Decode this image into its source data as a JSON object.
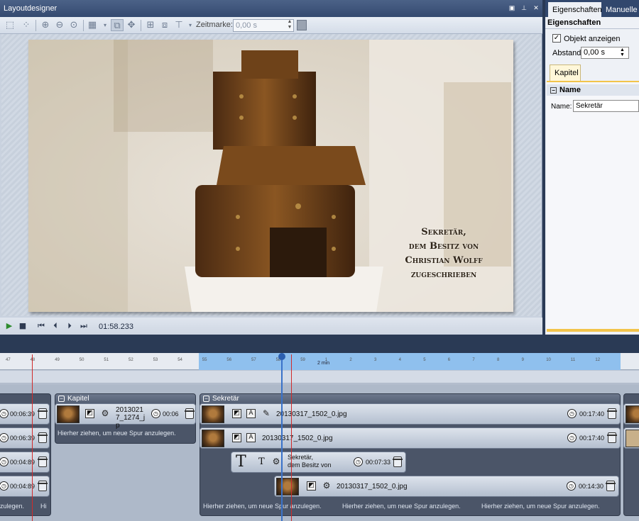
{
  "layoutdesigner": {
    "title": "Layoutdesigner",
    "zeitmarke_label": "Zeitmarke:",
    "zeitmarke_value": "0,00 s",
    "caption_lines": [
      "Sekretär,",
      "dem Besitz von",
      "Christian Wolff",
      "zugeschrieben"
    ],
    "timecode": "01:58.233"
  },
  "properties": {
    "tabs": [
      "Eigenschaften",
      "Manuelle Ei"
    ],
    "heading": "Eigenschaften",
    "show_object_label": "Objekt anzeigen",
    "show_object_checked": true,
    "abstand_label": "Abstand:",
    "abstand_value": "0,00 s",
    "section_tab": "Kapitel",
    "name_header": "Name",
    "name_label": "Name:",
    "name_value": "Sekretär"
  },
  "timeline": {
    "ruler_ticks": [
      "47",
      "48",
      "49",
      "50",
      "51",
      "52",
      "53",
      "54",
      "55",
      "56",
      "57",
      "58",
      "59",
      "1",
      "2",
      "3",
      "4",
      "5",
      "6",
      "7",
      "8",
      "9",
      "10",
      "11",
      "12"
    ],
    "ruler_major": "2 min",
    "chapters": [
      {
        "name": "Kapitel",
        "clip_name": "20130217_1274_jp",
        "clip_duration": "00:06",
        "hint": "Hierher ziehen, um neue Spur anzulegen."
      },
      {
        "name": "Sekretär",
        "hint": "Hierher ziehen, um neue Spur anzulegen."
      }
    ],
    "left_durations": [
      "00:06:39",
      "00:06:39",
      "00:04:89",
      "00:04:89"
    ],
    "left_hint_a": "zulegen.",
    "left_hint_b": "Hi",
    "sek_tracks": [
      {
        "file": "20130317_1502_0.jpg",
        "duration": "00:17:40"
      },
      {
        "file": "20130317_1502_0.jpg",
        "duration": "00:17:40"
      },
      {
        "text_lines": [
          "Sekretär,",
          "dem Besitz von"
        ],
        "duration": "00:07:33"
      },
      {
        "file": "20130317_1502_0.jpg",
        "duration": "00:14:30"
      }
    ]
  }
}
